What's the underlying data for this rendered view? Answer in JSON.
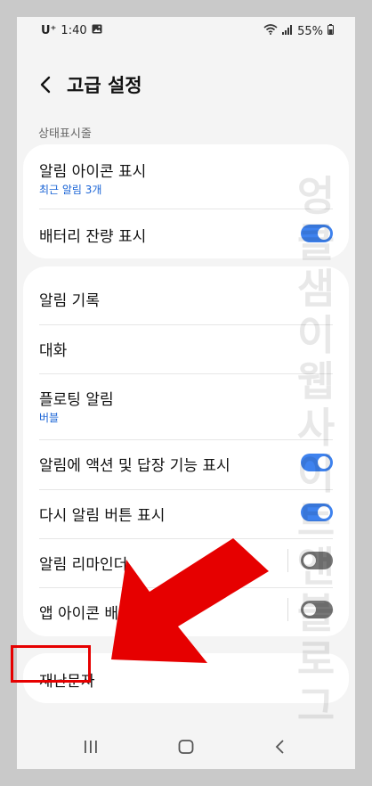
{
  "status_bar": {
    "carrier": "U⁺",
    "time": "1:40",
    "battery_percent": "55%"
  },
  "header": {
    "title": "고급 설정"
  },
  "section": {
    "label": "상태표시줄"
  },
  "card1": {
    "items": [
      {
        "title": "알림 아이콘 표시",
        "subtitle": "최근 알림 3개"
      },
      {
        "title": "배터리 잔량 표시",
        "toggle": true
      }
    ]
  },
  "card2": {
    "items": [
      {
        "title": "알림 기록"
      },
      {
        "title": "대화"
      },
      {
        "title": "플로팅 알림",
        "subtitle": "버블"
      },
      {
        "title": "알림에 액션 및 답장 기능 표시",
        "toggle": true
      },
      {
        "title": "다시 알림 버튼 표시",
        "toggle": true
      },
      {
        "title": "알림 리마인더",
        "toggle": false
      },
      {
        "title": "앱 아이콘 배지",
        "toggle": false
      }
    ]
  },
  "card3": {
    "items": [
      {
        "title": "재난문자"
      }
    ]
  },
  "watermark": "엉클샘이웹사이트앤블로그",
  "annotation": {
    "arrow_color": "#e60000"
  },
  "colors": {
    "accent": "#3e82ee",
    "subtitle": "#1a64d6",
    "background": "#f4f4f4"
  }
}
